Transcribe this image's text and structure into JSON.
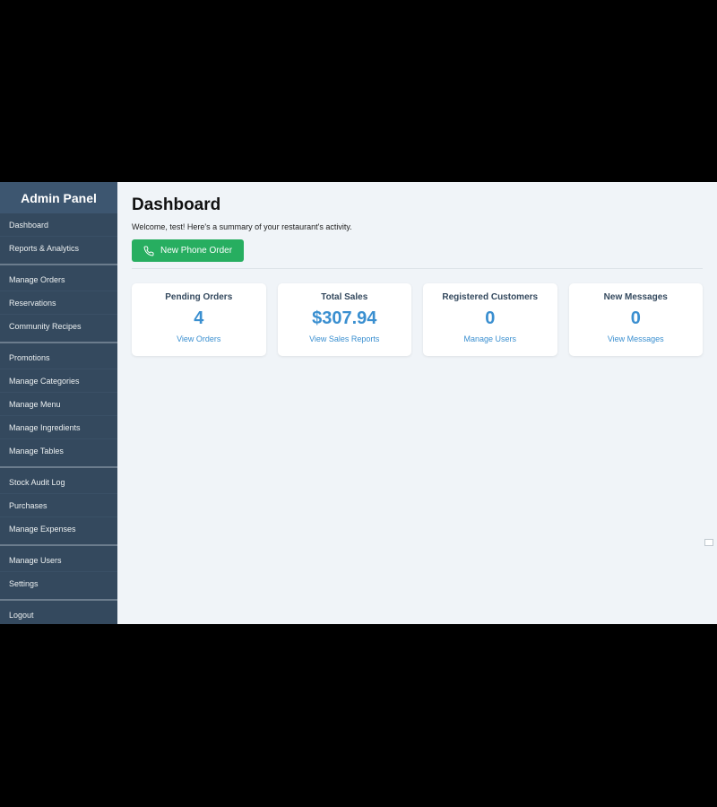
{
  "sidebar": {
    "title": "Admin Panel",
    "groups": [
      [
        "Dashboard",
        "Reports & Analytics"
      ],
      [
        "Manage Orders",
        "Reservations",
        "Community Recipes"
      ],
      [
        "Promotions",
        "Manage Categories",
        "Manage Menu",
        "Manage Ingredients",
        "Manage Tables"
      ],
      [
        "Stock Audit Log",
        "Purchases",
        "Manage Expenses"
      ],
      [
        "Manage Users",
        "Settings"
      ],
      [
        "Logout"
      ]
    ]
  },
  "main": {
    "title": "Dashboard",
    "welcome": "Welcome, test! Here's a summary of your restaurant's activity.",
    "new_order_label": "New Phone Order",
    "cards": [
      {
        "title": "Pending Orders",
        "value": "4",
        "link": "View Orders"
      },
      {
        "title": "Total Sales",
        "value": "$307.94",
        "link": "View Sales Reports"
      },
      {
        "title": "Registered Customers",
        "value": "0",
        "link": "Manage Users"
      },
      {
        "title": "New Messages",
        "value": "0",
        "link": "View Messages"
      }
    ]
  }
}
